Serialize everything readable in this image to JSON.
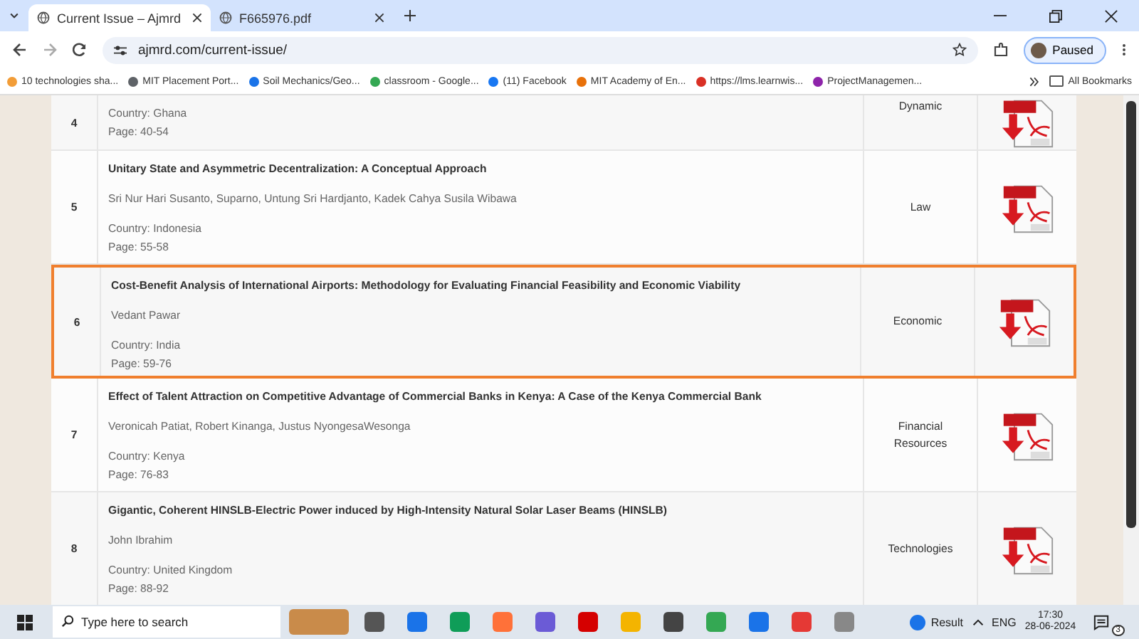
{
  "browser": {
    "tabs": [
      {
        "title": "Current Issue – Ajmrd",
        "selected": true
      },
      {
        "title": "F665976.pdf",
        "selected": false
      }
    ],
    "address": "ajmrd.com/current-issue/",
    "profile": "Paused",
    "bookmarks": [
      "10 technologies sha...",
      "MIT Placement Port...",
      "Soil Mechanics/Geo...",
      "classroom - Google...",
      "(11) Facebook",
      "MIT Academy of En...",
      "https://lms.learnwis...",
      "ProjectManagemen..."
    ],
    "all_bookmarks": "All Bookmarks"
  },
  "articles": [
    {
      "number": "4",
      "country": "Country: Ghana",
      "pages": "Page: 40-54",
      "category": "Dynamic",
      "highlighted": false
    },
    {
      "number": "5",
      "title": "Unitary State and Asymmetric Decentralization: A Conceptual Approach",
      "authors": "Sri Nur Hari Susanto, Suparno, Untung Sri Hardjanto, Kadek Cahya Susila Wibawa",
      "country": "Country: Indonesia",
      "pages": "Page: 55-58",
      "category": "Law",
      "highlighted": false
    },
    {
      "number": "6",
      "title": "Cost-Benefit Analysis of International Airports: Methodology for Evaluating Financial Feasibility and Economic Viability",
      "authors": "Vedant Pawar",
      "country": "Country: India",
      "pages": "Page: 59-76",
      "category": "Economic",
      "highlighted": true
    },
    {
      "number": "7",
      "title": "Effect of Talent Attraction on Competitive Advantage of Commercial Banks in Kenya: A Case of the Kenya Commercial Bank",
      "authors": "Veronicah Patiat, Robert Kinanga, Justus NyongesaWesonga",
      "country": "Country: Kenya",
      "pages": "Page: 76-83",
      "category": "Financial Resources",
      "highlighted": false
    },
    {
      "number": "8",
      "title": "Gigantic, Coherent HINSLB-Electric Power induced by High-Intensity Natural Solar Laser Beams (HINSLB)",
      "authors": "John Ibrahim",
      "country": "Country: United Kingdom",
      "pages": "Page: 88-92",
      "category": "Technologies",
      "highlighted": false
    }
  ],
  "taskbar": {
    "search_placeholder": "Type here to search",
    "weather": "Result",
    "language": "ENG",
    "time": "17:30",
    "date": "28-06-2024",
    "notifications": "3"
  }
}
